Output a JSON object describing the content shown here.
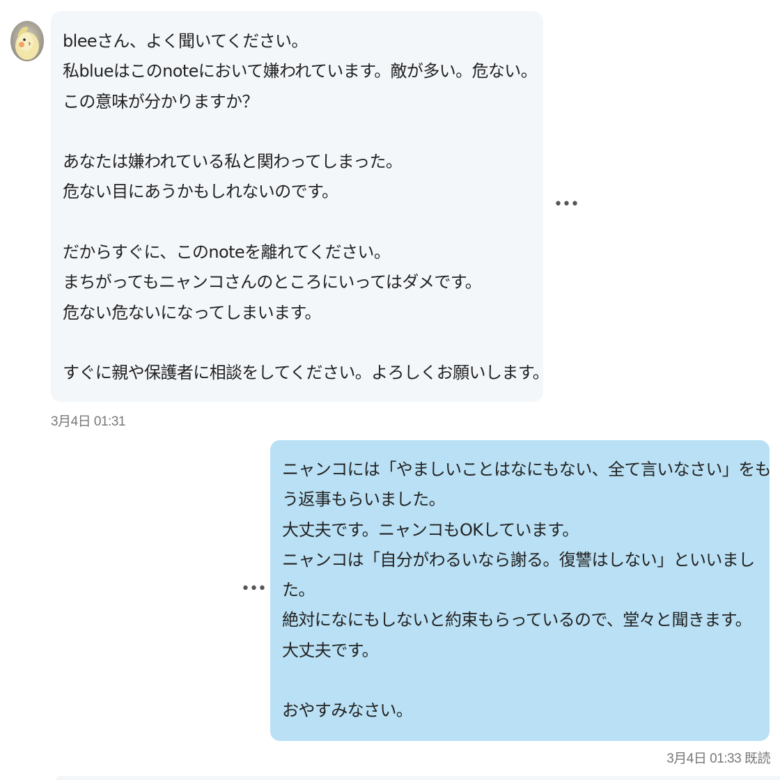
{
  "conversation": {
    "incoming": {
      "avatar_icon": "bird-avatar-icon",
      "lines": [
        "bleeさん、よく聞いてください。",
        "私blueはこのnoteにおいて嫌われています。敵が多い。危ない。",
        "この意味が分かりますか？",
        "",
        "あなたは嫌われている私と関わってしまった。",
        "危ない目にあうかもしれないのです。",
        "",
        "だからすぐに、このnoteを離れてください。",
        "まちがってもニャンコさんのところにいってはダメです。",
        "危ない危ないになってしまいます。",
        "",
        "すぐに親や保護者に相談をしてください。よろしくお願いします。"
      ],
      "timestamp": "3月4日 01:31",
      "more_icon": "more-options-icon",
      "bubble_color": "#f4f7fa"
    },
    "outgoing": {
      "lines": [
        "ニャンコには「やましいことはなにもない、全て言いなさい」をも",
        "う返事もらいました。",
        "大丈夫です。ニャンコもOKしています。",
        "ニャンコは「自分がわるいなら謝る。復讐はしない」といいまし",
        "た。",
        "絶対になにもしないと約束もらっているので、堂々と聞きます。",
        "大丈夫です。",
        "",
        "おやすみなさい。"
      ],
      "timestamp": "3月4日 01:33",
      "read_status": "既読",
      "more_icon": "more-options-icon",
      "bubble_color": "#b9e0f4"
    }
  }
}
